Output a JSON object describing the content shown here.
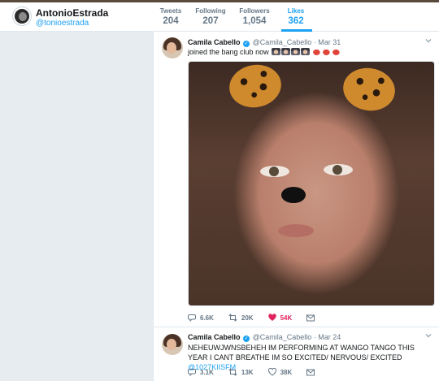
{
  "profile": {
    "name": "AntonioEstrada",
    "handle": "@tonioestrada",
    "stats": [
      {
        "label": "Tweets",
        "value": "204"
      },
      {
        "label": "Following",
        "value": "207"
      },
      {
        "label": "Followers",
        "value": "1,054"
      },
      {
        "label": "Likes",
        "value": "362"
      }
    ],
    "active_tab": "Likes"
  },
  "tweets": [
    {
      "name": "Camila Cabello",
      "handle": "@Camila_Cabello",
      "separator": "·",
      "date": "Mar 31",
      "text": "joined the bang club now",
      "emojis": [
        "woman-face",
        "woman-face",
        "woman-face",
        "woman-face",
        "hot-pepper",
        "hot-pepper",
        "hot-pepper"
      ],
      "actions": {
        "replies": "6.6K",
        "retweets": "20K",
        "likes": "54K",
        "liked": true
      }
    },
    {
      "name": "Camila Cabello",
      "handle": "@Camila_Cabello",
      "separator": "·",
      "date": "Mar 24",
      "text": "NEHEUWJWNSBEHEH IM PERFORMING AT WANGO TANGO THIS YEAR I CANT BREATHE IM SO EXCITED/ NERVOUS/ EXCITED",
      "mention": "@1027KIISFM",
      "actions": {
        "replies": "3.1K",
        "retweets": "13K",
        "likes": "38K",
        "liked": false
      }
    }
  ],
  "colors": {
    "accent": "#1da1f2",
    "like": "#e0245e",
    "muted": "#657786",
    "background": "#e6ecf0"
  }
}
